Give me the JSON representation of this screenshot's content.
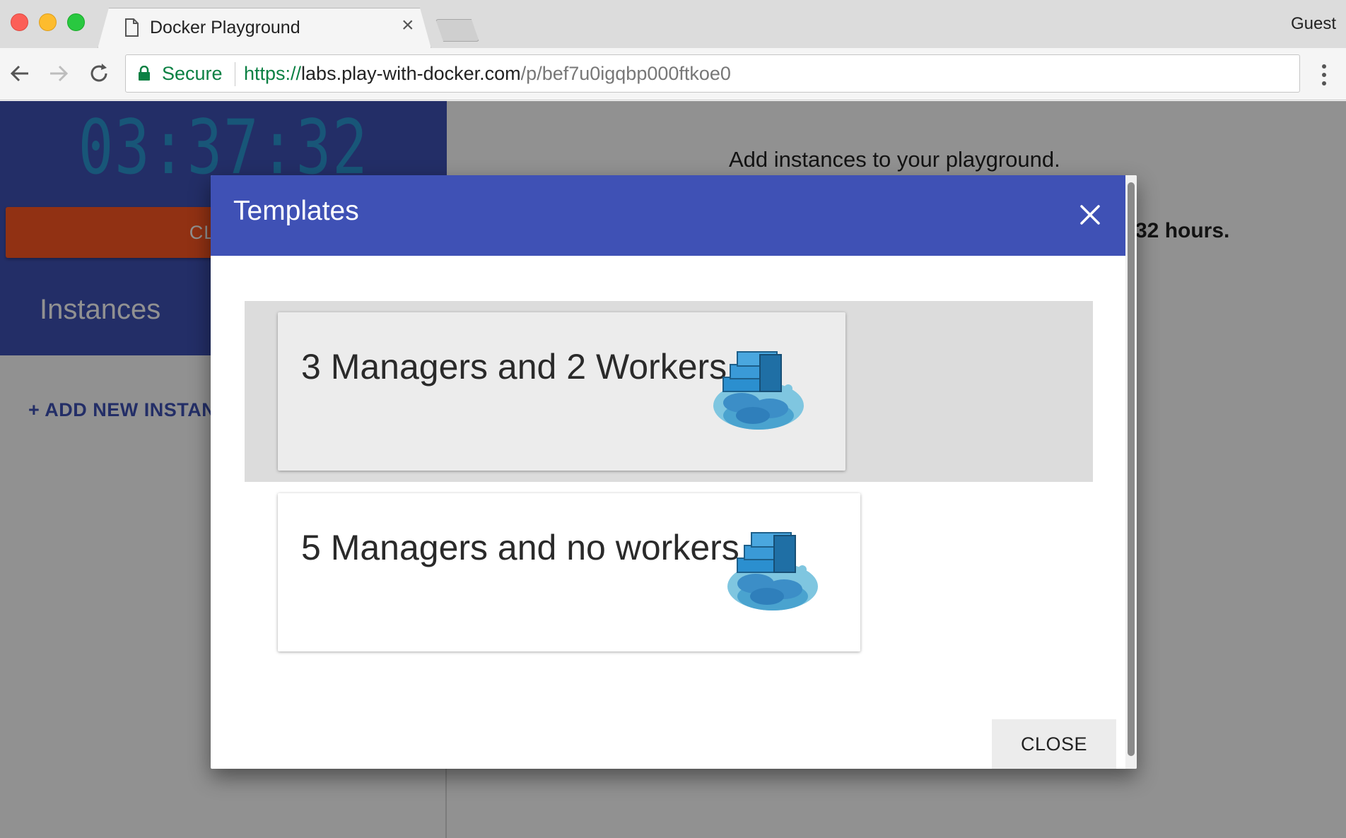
{
  "browser": {
    "tab_title": "Docker Playground",
    "tab_close": "×",
    "profile": "Guest",
    "secure_label": "Secure",
    "url_protocol": "https://",
    "url_host": "labs.play-with-docker.com",
    "url_path": "/p/bef7u0igqbp000ftkoe0"
  },
  "sidebar": {
    "timer": "03:37:32",
    "close_session_label": "CLOSE",
    "instances_label": "Instances",
    "add_instance_label": "+ ADD NEW INSTANC"
  },
  "main": {
    "message": "Add instances to your playground.",
    "hours_text": "32 hours."
  },
  "dialog": {
    "title": "Templates",
    "templates": [
      {
        "label": "3 Managers and 2 Workers",
        "icon": "docker-swarm-whale-icon",
        "state": "hover"
      },
      {
        "label": "5 Managers and no workers",
        "icon": "docker-swarm-whale-icon",
        "state": "normal"
      }
    ],
    "close_label": "CLOSE"
  },
  "colors": {
    "primary": "#3f51b5",
    "accent": "#ff5722",
    "timer": "#2b98d3",
    "secure": "#0b8043"
  }
}
